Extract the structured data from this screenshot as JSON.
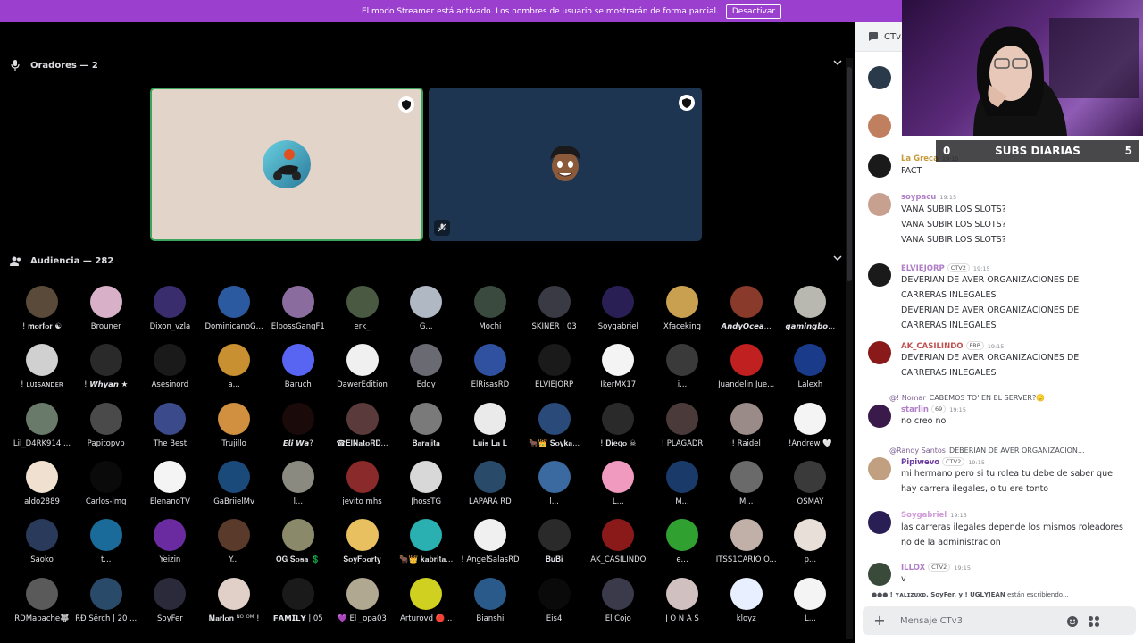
{
  "banner": {
    "text": "El modo Streamer está activado. Los nombres de usuario se mostrarán de forma parcial.",
    "button": "Desactivar",
    "color": "#9b3fcf"
  },
  "speakers": {
    "title": "Oradores — 2",
    "icon": "microphone-icon",
    "tiles": [
      {
        "bg": "#e2d4c8",
        "border": "#3ba55d",
        "avatar_icon": "motorcycle-rider-avatar",
        "shield_icon": "shield-icon"
      },
      {
        "bg": "#1e3552",
        "border": "#1e3552",
        "avatar_icon": "cartoon-boy-avatar",
        "shield_icon": "shield-icon",
        "muted_icon": "muted-mic-icon"
      }
    ]
  },
  "audience": {
    "title": "Audiencia — 282",
    "icon": "people-icon",
    "members": [
      "! 𝐦𝐨𝐫𝐟𝐨𝐫 ☯",
      "Brouner",
      "Dixon_vzla",
      "DominicanoG...",
      "ElbossGangF1",
      "erk_",
      "G...",
      "Mochi",
      "SKINER | 03",
      "Soygabriel",
      "Xfaceking",
      "𝘼𝙣𝙙𝙮𝙊𝙘𝙚𝙖...",
      "𝙜𝙖𝙢𝙞𝙣𝙜𝙗𝙤...",
      "! ʟᴜɪsᴀɴᴅᴇʀ",
      "! 𝙒𝙝𝙮𝙖𝙣 ★",
      "Asesinord",
      "a...",
      "Baruch",
      "DawerEdition",
      "Eddy",
      "ElRisasRD",
      "ELVIEJORP",
      "IkerMX17",
      "i...",
      "Juandelin Jue...",
      "Lalexh",
      "Lil_D4RK914 ...",
      "Papitopvp",
      "The Best",
      "Trujillo",
      "𝙀𝙡𝙞 𝙒𝙖?",
      "☎𝐄𝐥𝐍𝐚𝐭𝐨𝐑𝐃...",
      "𝐁𝐚𝐫𝐚𝐣𝐢𝐭𝐚",
      "𝐋𝐮𝐢𝐬 𝐋𝐚 𝐋",
      "🐂👑 𝐒𝐨𝐲𝐤𝐚...",
      "! 𝐃𝐢𝐞𝐠𝐨 ☠",
      "! PLAGADR",
      "! Raidel",
      "!Andrew 🤍",
      "aldo2889",
      "Carlos-lmg",
      "ElenanoTV",
      "GaBriielMv",
      "l...",
      "jevito mhs",
      "JhossTG",
      "LAPARA RD",
      "l...",
      "L...",
      "M...",
      "M...",
      "OSMAY",
      "Saoko",
      "t...",
      "Yeizin",
      "Y...",
      "𝐎𝐆 𝐒𝐨𝐬𝐚 💲",
      "𝐒𝐨𝐲𝐅𝐨𝐨𝐫𝐭𝐲",
      "🐂👑 𝐤𝐚𝐛𝐫𝐢𝐭𝐚...",
      "! AngelSalasRD",
      "𝐁𝐮𝐁𝐢",
      "AK_CASILINDO",
      "e...",
      "ITSS1CARIO O...",
      "p...",
      "RDMapache🐺",
      "RĐ Šěrçh | 20 ...",
      "SoyFer",
      "𝐌𝐚𝐫𝐥𝐨𝐧 ᴺᴼ ᴼᴹ !",
      "𝗙𝗔𝗠𝗜𝗟𝗬 | 05",
      "💜 El _opa03",
      "Arturovd 🔴...",
      "Bianshi",
      "Eis4",
      "El Cojo",
      "J O N A S",
      "kloyz",
      "L..."
    ],
    "colors": [
      "#5a4a3a",
      "#d8b0c8",
      "#3a2d6e",
      "#2c5aa0",
      "#8a6d9e",
      "#4a5a42",
      "#b0b8c4",
      "#3a4a3e",
      "#3a3a44",
      "#2a1f55",
      "#c8a050",
      "#8a3a2a",
      "#b8b8b0",
      "#d0d0d0",
      "#2a2a2a",
      "#1a1a1a",
      "#c89030",
      "#5865f2",
      "#f0f0f0",
      "#6a6a72",
      "#3050a0",
      "#1a1a1a",
      "#f4f4f4",
      "#3a3a3a",
      "#c02020",
      "#1a3a8a",
      "#6a7a6a",
      "#4a4a4a",
      "#3a4a8a",
      "#d09040",
      "#1a0a0a",
      "#5a3a3a",
      "#7a7a7a",
      "#eaeaea",
      "#2a4a7a",
      "#2a2a2a",
      "#4a3a3a",
      "#9a8a88",
      "#f4f4f4",
      "#f0e0d0",
      "#0a0a0a",
      "#f4f4f4",
      "#1a4a7a",
      "#8a8a80",
      "#8a2a2a",
      "#d8d8d8",
      "#2a4a6a",
      "#3a6aa0",
      "#f09ac0",
      "#1a3a6a",
      "#6a6a6a",
      "#3a3a3a",
      "#2a3a5a",
      "#1a6a9a",
      "#6a2aa0",
      "#5a3a2a",
      "#8a8a6a",
      "#e8c060",
      "#2ab0b0",
      "#f0f0f0",
      "#2a2a2a",
      "#8a1a1a",
      "#30a030",
      "#c0b0a8",
      "#e8e0d8",
      "#5a5a5a",
      "#2a4a6a",
      "#2a2a3a",
      "#e0d0c8",
      "#1a1a1a",
      "#b0a890",
      "#d0d020",
      "#2a5a8a",
      "#0a0a0a",
      "#3a3a4a",
      "#d0c0c0",
      "#e8f0ff",
      "#f4f4f4"
    ]
  },
  "chat": {
    "channel": "CTv3",
    "channel_icon": "chat-bubble-icon",
    "messages": [
      {
        "avatar_color": "#2a3a4a",
        "lines": []
      },
      {
        "avatar_color": "#c08060",
        "lines": []
      },
      {
        "user": "La Greca",
        "user_color": "#c69a3a",
        "badge": "",
        "time": "19:15",
        "avatar_color": "#1a1a1a",
        "lines": [
          "FACT"
        ]
      },
      {
        "user": "soypacu",
        "user_color": "#b07fc8",
        "badge": "",
        "time": "19:15",
        "avatar_color": "#c8a090",
        "lines": [
          "VANA SUBIR LOS SLOTS?",
          "VANA SUBIR LOS SLOTS?",
          "VANA SUBIR LOS SLOTS?"
        ]
      },
      {
        "user": "ELVIEJORP",
        "user_color": "#b07fc8",
        "badge": "CTV2",
        "time": "19:15",
        "avatar_color": "#1a1a1a",
        "lines": [
          "DEVERIAN DE AVER  ORGANIZACIONES  DE",
          "CARRERAS INLEGALES",
          "DEVERIAN DE AVER  ORGANIZACIONES  DE",
          "CARRERAS INLEGALES"
        ]
      },
      {
        "user": "AK_CASILINDO",
        "user_color": "#c05050",
        "badge": "FRP",
        "time": "19:15",
        "avatar_color": "#8a1a1a",
        "lines": [
          "DEVERIAN DE AVER  ORGANIZACIONES  DE",
          "CARRERAS INLEGALES"
        ]
      },
      {
        "reply_user": "@! Nomar",
        "reply_text": "CABEMOS TO' EN EL SERVER?🙂",
        "user": "starlin",
        "user_color": "#b07fc8",
        "badge": "69",
        "time": "19:15",
        "avatar_color": "#3a1a4a",
        "lines": [
          "no creo no"
        ]
      },
      {
        "reply_user": "@Randy Santos",
        "reply_text": "DEBERIAN DE AVER ORGANIZACION...",
        "user": "Pipiwevo",
        "user_color": "#6a3aa0",
        "badge": "CTV2",
        "time": "19:15",
        "avatar_color": "#c0a080",
        "lines": [
          "mi hermano pero si tu rolea tu debe de saber que",
          "hay carrera ilegales, o tu ere tonto"
        ]
      },
      {
        "user": "Soygabriel",
        "user_color": "#d09ad8",
        "badge": "",
        "time": "19:15",
        "avatar_color": "#2a1f55",
        "lines": [
          "las carreras ilegales depende los mismos roleadores",
          "no de la administracion"
        ]
      },
      {
        "user": "ILLOX",
        "user_color": "#b07fc8",
        "badge": "CTV2",
        "time": "19:15",
        "avatar_color": "#3a4a3a",
        "lines": [
          "v"
        ]
      }
    ],
    "typing_names": "! ʏᴀʟɪᴢᴜxᴅ, SoyFer, y ! 𝗨𝗚𝗟𝗬𝗝𝗘𝗔𝗡",
    "typing_suffix": "están escribiendo...",
    "input_placeholder": "Mensaje CTv3",
    "composer_icons": [
      "plus-icon",
      "emoji-icon",
      "apps-icon",
      "gift-icon"
    ]
  },
  "overlay": {
    "subs_left": "0",
    "subs_label": "SUBS DIARIAS",
    "subs_right": "5"
  }
}
